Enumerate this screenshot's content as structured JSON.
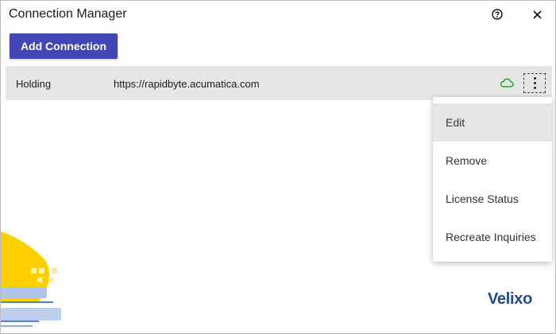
{
  "window": {
    "title": "Connection Manager"
  },
  "titlebar": {
    "help_icon": "question-circle-icon",
    "close_icon": "close-icon"
  },
  "toolbar": {
    "add_label": "Add Connection"
  },
  "connections": [
    {
      "name": "Holding",
      "url": "https://rapidbyte.acumatica.com",
      "status_icon": "cloud-icon",
      "status_color": "#22a822"
    }
  ],
  "context_menu": {
    "items": [
      "Edit",
      "Remove",
      "License Status",
      "Recreate Inquiries"
    ],
    "hovered": "Edit"
  },
  "brand": {
    "logo_text": "Velixo",
    "accent": "#4347b6",
    "logo_color": "#1f4b8e"
  }
}
